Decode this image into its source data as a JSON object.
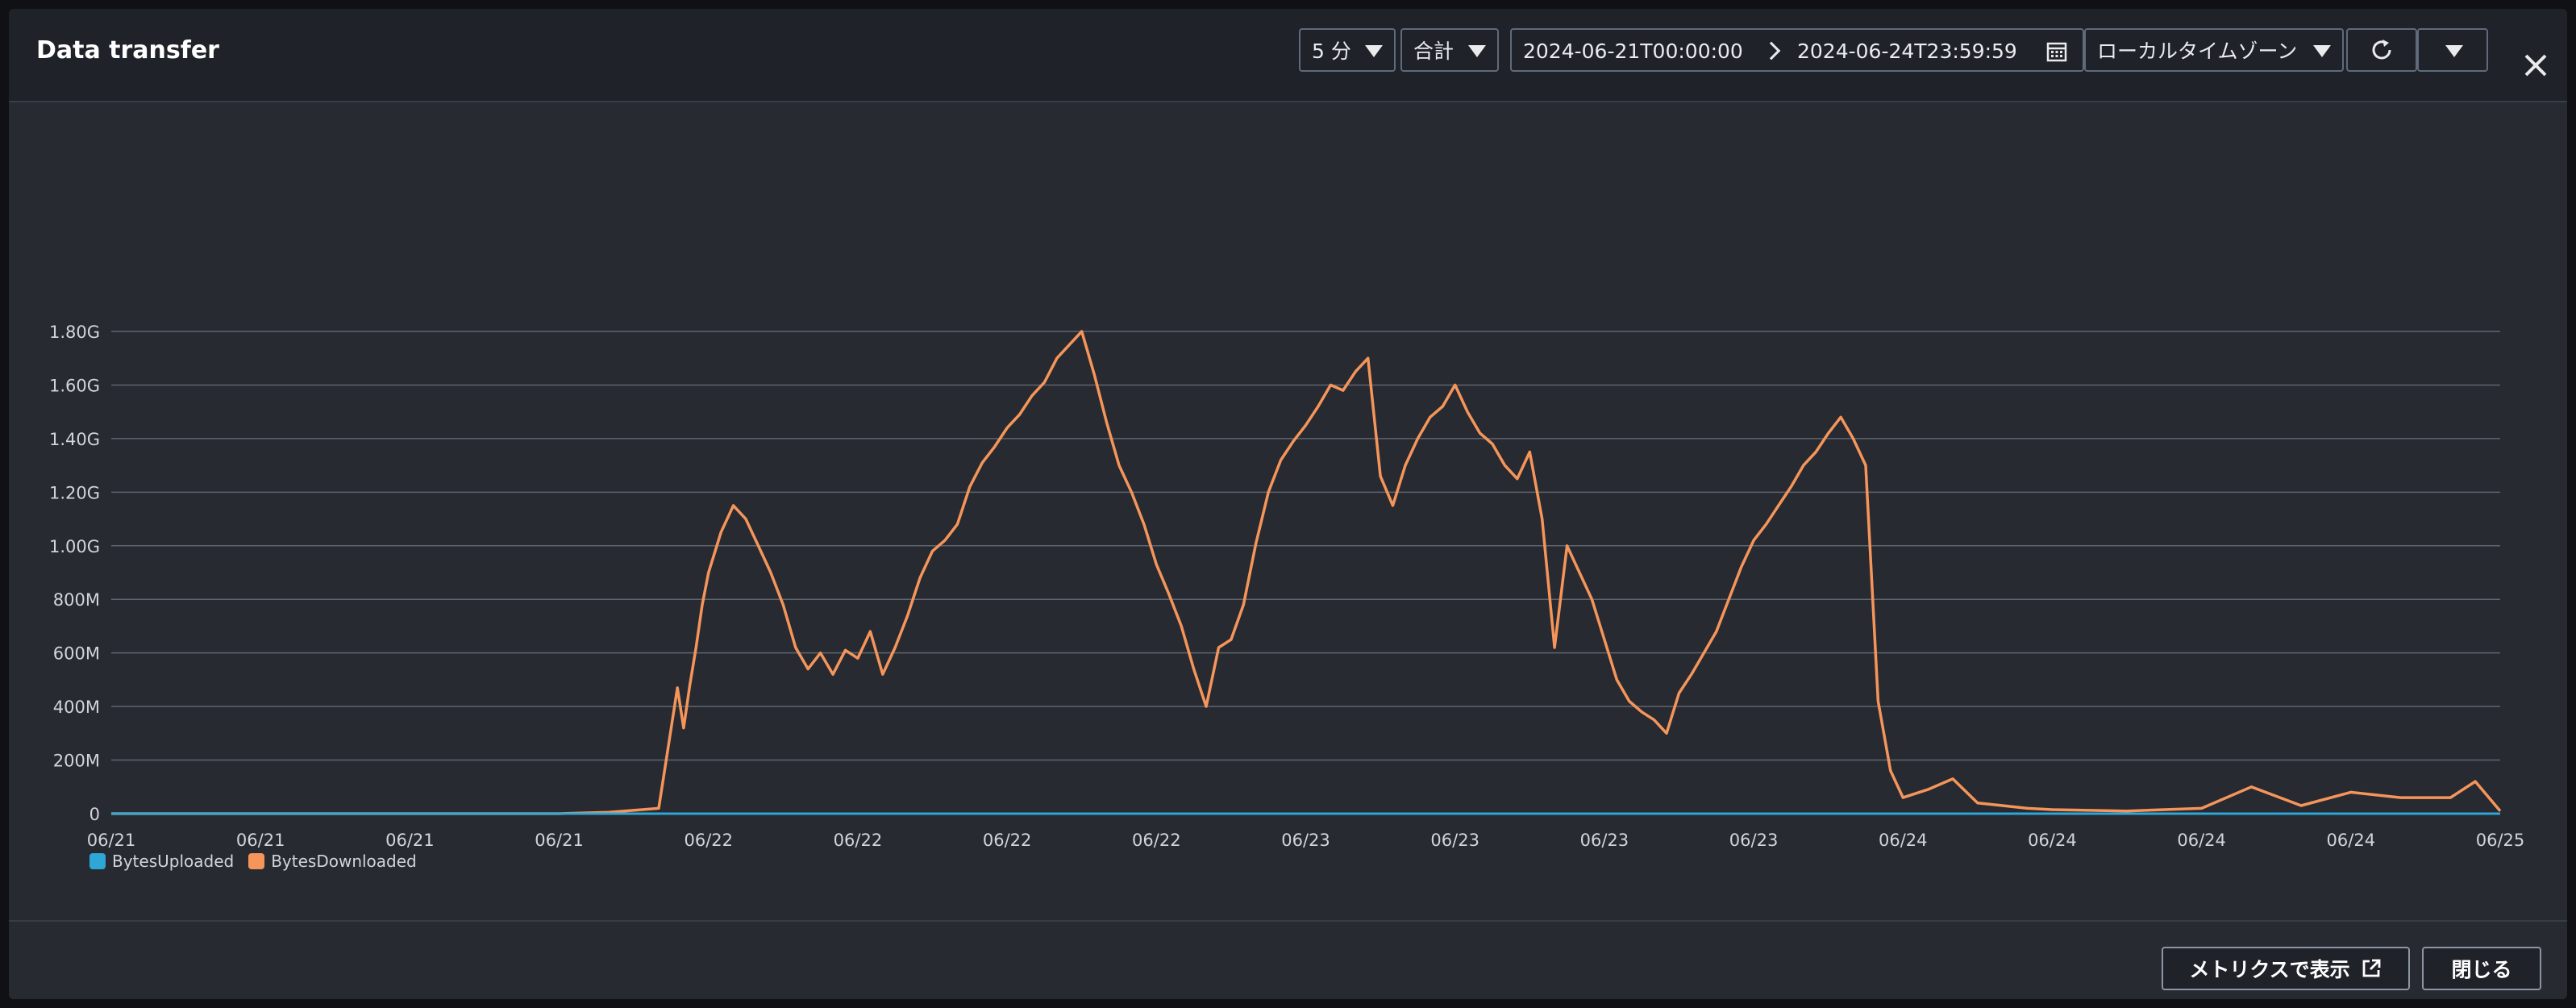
{
  "header": {
    "title": "Data transfer",
    "period": "5 分",
    "stat": "合計",
    "start": "2024-06-21T00:00:00",
    "end": "2024-06-24T23:59:59",
    "timezone": "ローカルタイムゾーン"
  },
  "footer": {
    "view_metrics": "メトリクスで表示",
    "close": "閉じる"
  },
  "colors": {
    "uploaded": "#2ea7d6",
    "downloaded": "#f5955a",
    "grid": "#5f656e",
    "axis_text": "#d1d5db"
  },
  "chart_data": {
    "type": "line",
    "title": "",
    "xlabel": "",
    "ylabel": "",
    "ylim": [
      0,
      1800000000
    ],
    "yticks": [
      {
        "value": 0,
        "label": "0"
      },
      {
        "value": 200000000,
        "label": "200M"
      },
      {
        "value": 400000000,
        "label": "400M"
      },
      {
        "value": 600000000,
        "label": "600M"
      },
      {
        "value": 800000000,
        "label": "800M"
      },
      {
        "value": 1000000000,
        "label": "1.00G"
      },
      {
        "value": 1200000000,
        "label": "1.20G"
      },
      {
        "value": 1400000000,
        "label": "1.40G"
      },
      {
        "value": 1600000000,
        "label": "1.60G"
      },
      {
        "value": 1800000000,
        "label": "1.80G"
      }
    ],
    "xlim": [
      "2024-06-21T00:00:00",
      "2024-06-25T00:00:00"
    ],
    "xticks": [
      {
        "x": "2024-06-21T00:00",
        "label": "06/21"
      },
      {
        "x": "2024-06-21T06:00",
        "label": "06/21"
      },
      {
        "x": "2024-06-21T12:00",
        "label": "06/21"
      },
      {
        "x": "2024-06-21T18:00",
        "label": "06/21"
      },
      {
        "x": "2024-06-22T00:00",
        "label": "06/22"
      },
      {
        "x": "2024-06-22T06:00",
        "label": "06/22"
      },
      {
        "x": "2024-06-22T12:00",
        "label": "06/22"
      },
      {
        "x": "2024-06-22T18:00",
        "label": "06/22"
      },
      {
        "x": "2024-06-23T00:00",
        "label": "06/23"
      },
      {
        "x": "2024-06-23T06:00",
        "label": "06/23"
      },
      {
        "x": "2024-06-23T12:00",
        "label": "06/23"
      },
      {
        "x": "2024-06-23T18:00",
        "label": "06/23"
      },
      {
        "x": "2024-06-24T00:00",
        "label": "06/24"
      },
      {
        "x": "2024-06-24T06:00",
        "label": "06/24"
      },
      {
        "x": "2024-06-24T12:00",
        "label": "06/24"
      },
      {
        "x": "2024-06-24T18:00",
        "label": "06/24"
      },
      {
        "x": "2024-06-25T00:00",
        "label": "06/25"
      }
    ],
    "legend": "bottom-left",
    "grid": true,
    "series": [
      {
        "name": "BytesUploaded",
        "color": "#2ea7d6",
        "x": [
          "2024-06-21T00:00",
          "2024-06-22T00:00",
          "2024-06-23T00:00",
          "2024-06-24T00:00",
          "2024-06-25T00:00"
        ],
        "values": [
          0,
          0,
          0,
          0,
          0
        ]
      },
      {
        "name": "BytesDownloaded",
        "color": "#f5955a",
        "x": [
          "2024-06-21T00:00",
          "2024-06-21T06:00",
          "2024-06-21T12:00",
          "2024-06-21T18:00",
          "2024-06-21T20:00",
          "2024-06-21T22:00",
          "2024-06-21T22:45",
          "2024-06-21T23:00",
          "2024-06-21T23:15",
          "2024-06-21T23:30",
          "2024-06-21T23:45",
          "2024-06-22T00:00",
          "2024-06-22T00:30",
          "2024-06-22T01:00",
          "2024-06-22T01:30",
          "2024-06-22T02:00",
          "2024-06-22T02:30",
          "2024-06-22T03:00",
          "2024-06-22T03:30",
          "2024-06-22T04:00",
          "2024-06-22T04:30",
          "2024-06-22T05:00",
          "2024-06-22T05:30",
          "2024-06-22T06:00",
          "2024-06-22T06:30",
          "2024-06-22T07:00",
          "2024-06-22T07:30",
          "2024-06-22T08:00",
          "2024-06-22T08:30",
          "2024-06-22T09:00",
          "2024-06-22T09:30",
          "2024-06-22T10:00",
          "2024-06-22T10:30",
          "2024-06-22T11:00",
          "2024-06-22T11:30",
          "2024-06-22T12:00",
          "2024-06-22T12:30",
          "2024-06-22T13:00",
          "2024-06-22T13:30",
          "2024-06-22T14:00",
          "2024-06-22T14:30",
          "2024-06-22T15:00",
          "2024-06-22T15:30",
          "2024-06-22T16:00",
          "2024-06-22T16:30",
          "2024-06-22T17:00",
          "2024-06-22T17:30",
          "2024-06-22T18:00",
          "2024-06-22T18:30",
          "2024-06-22T19:00",
          "2024-06-22T19:30",
          "2024-06-22T20:00",
          "2024-06-22T20:30",
          "2024-06-22T21:00",
          "2024-06-22T21:30",
          "2024-06-22T22:00",
          "2024-06-22T22:30",
          "2024-06-22T23:00",
          "2024-06-22T23:30",
          "2024-06-23T00:00",
          "2024-06-23T00:30",
          "2024-06-23T01:00",
          "2024-06-23T01:30",
          "2024-06-23T02:00",
          "2024-06-23T02:30",
          "2024-06-23T03:00",
          "2024-06-23T03:30",
          "2024-06-23T04:00",
          "2024-06-23T04:30",
          "2024-06-23T05:00",
          "2024-06-23T05:30",
          "2024-06-23T06:00",
          "2024-06-23T06:30",
          "2024-06-23T07:00",
          "2024-06-23T07:30",
          "2024-06-23T08:00",
          "2024-06-23T08:30",
          "2024-06-23T09:00",
          "2024-06-23T09:30",
          "2024-06-23T10:00",
          "2024-06-23T10:30",
          "2024-06-23T11:00",
          "2024-06-23T11:30",
          "2024-06-23T12:00",
          "2024-06-23T12:30",
          "2024-06-23T13:00",
          "2024-06-23T13:30",
          "2024-06-23T14:00",
          "2024-06-23T14:30",
          "2024-06-23T15:00",
          "2024-06-23T15:30",
          "2024-06-23T16:00",
          "2024-06-23T16:30",
          "2024-06-23T17:00",
          "2024-06-23T17:30",
          "2024-06-23T18:00",
          "2024-06-23T18:30",
          "2024-06-23T19:00",
          "2024-06-23T19:30",
          "2024-06-23T20:00",
          "2024-06-23T20:30",
          "2024-06-23T21:00",
          "2024-06-23T21:30",
          "2024-06-23T22:00",
          "2024-06-23T22:30",
          "2024-06-23T23:00",
          "2024-06-23T23:30",
          "2024-06-24T00:00",
          "2024-06-24T01:00",
          "2024-06-24T02:00",
          "2024-06-24T03:00",
          "2024-06-24T04:00",
          "2024-06-24T05:00",
          "2024-06-24T06:00",
          "2024-06-24T09:00",
          "2024-06-24T12:00",
          "2024-06-24T14:00",
          "2024-06-24T16:00",
          "2024-06-24T18:00",
          "2024-06-24T20:00",
          "2024-06-24T22:00",
          "2024-06-24T23:00",
          "2024-06-25T00:00"
        ],
        "values": [
          0,
          0,
          0,
          0,
          5000000,
          20000000,
          470000000,
          320000000,
          480000000,
          620000000,
          780000000,
          900000000,
          1050000000,
          1150000000,
          1100000000,
          1000000000,
          900000000,
          780000000,
          620000000,
          540000000,
          600000000,
          520000000,
          610000000,
          580000000,
          680000000,
          520000000,
          620000000,
          740000000,
          880000000,
          980000000,
          1020000000,
          1080000000,
          1220000000,
          1310000000,
          1370000000,
          1440000000,
          1490000000,
          1560000000,
          1610000000,
          1700000000,
          1750000000,
          1800000000,
          1640000000,
          1460000000,
          1300000000,
          1200000000,
          1080000000,
          930000000,
          820000000,
          700000000,
          540000000,
          400000000,
          620000000,
          650000000,
          780000000,
          1010000000,
          1200000000,
          1320000000,
          1390000000,
          1450000000,
          1520000000,
          1600000000,
          1580000000,
          1650000000,
          1700000000,
          1260000000,
          1150000000,
          1300000000,
          1400000000,
          1480000000,
          1520000000,
          1600000000,
          1500000000,
          1420000000,
          1380000000,
          1300000000,
          1250000000,
          1350000000,
          1100000000,
          620000000,
          1000000000,
          900000000,
          800000000,
          650000000,
          500000000,
          420000000,
          380000000,
          350000000,
          300000000,
          450000000,
          520000000,
          600000000,
          680000000,
          800000000,
          920000000,
          1020000000,
          1080000000,
          1150000000,
          1220000000,
          1300000000,
          1350000000,
          1420000000,
          1480000000,
          1400000000,
          1300000000,
          420000000,
          160000000,
          60000000,
          90000000,
          130000000,
          40000000,
          30000000,
          20000000,
          15000000,
          10000000,
          20000000,
          100000000,
          30000000,
          80000000,
          60000000,
          60000000,
          120000000,
          10000000
        ]
      }
    ]
  }
}
